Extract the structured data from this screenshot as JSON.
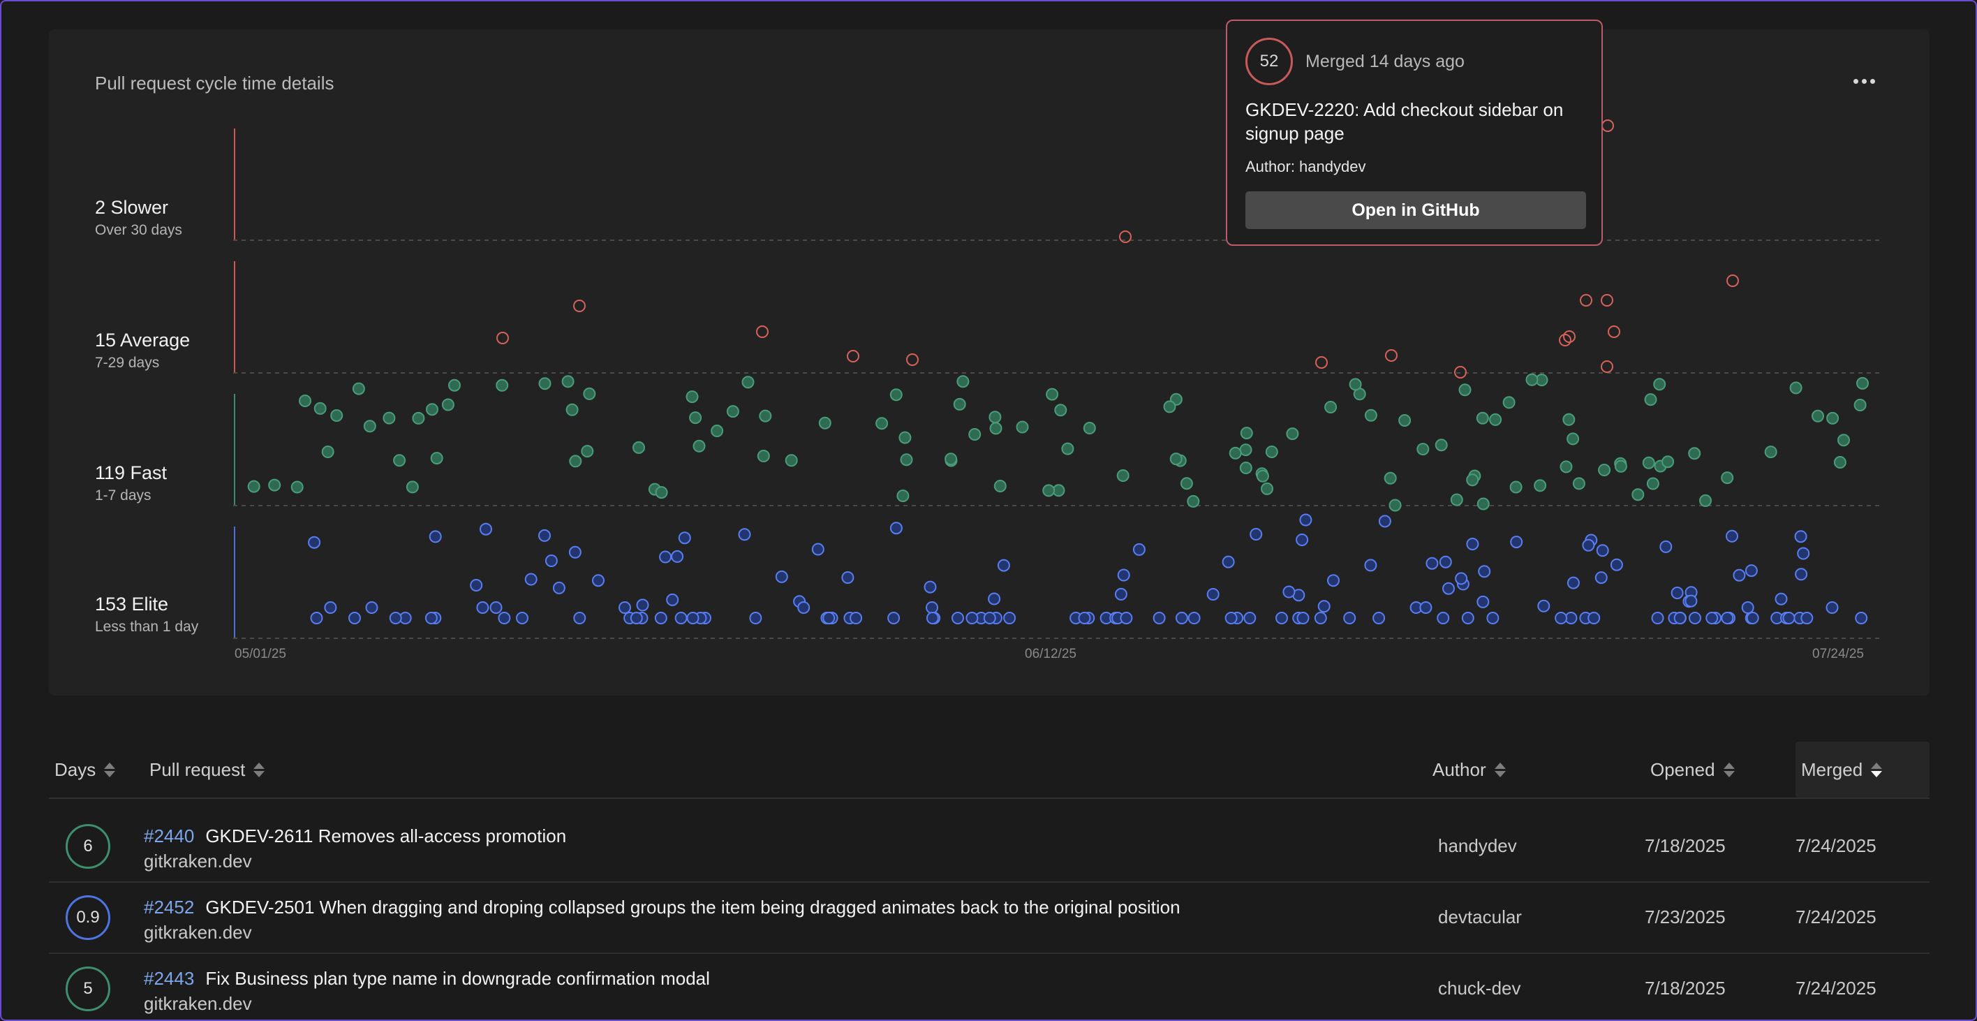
{
  "chart": {
    "title": "Pull request cycle time details",
    "x_ticks": [
      "05/01/25",
      "06/12/25",
      "07/24/25"
    ],
    "bands": [
      {
        "count_label": "2 Slower",
        "range_label": "Over 30 days"
      },
      {
        "count_label": "15 Average",
        "range_label": "7-29 days"
      },
      {
        "count_label": "119 Fast",
        "range_label": "1-7 days"
      },
      {
        "count_label": "153 Elite",
        "range_label": "Less than 1 day"
      }
    ],
    "colors": {
      "slower": "#d0574f",
      "average": "#d0574f",
      "fast": "#3f8f6f",
      "elite": "#4a6fe0"
    }
  },
  "popover": {
    "days": "52",
    "status": "Merged 14 days ago",
    "title": "GKDEV-2220: Add checkout sidebar on signup page",
    "author": "Author: handydev",
    "button_label": "Open in GitHub"
  },
  "table": {
    "columns": {
      "days": "Days",
      "pull_request": "Pull request",
      "author": "Author",
      "opened": "Opened",
      "merged": "Merged"
    },
    "active_sort": "merged",
    "rows": [
      {
        "days": "6",
        "band": "fast",
        "number": "#2440",
        "title": "GKDEV-2611 Removes all-access promotion",
        "repo": "gitkraken.dev",
        "author": "handydev",
        "opened": "7/18/2025",
        "merged": "7/24/2025"
      },
      {
        "days": "0.9",
        "band": "elite",
        "number": "#2452",
        "title": "GKDEV-2501 When dragging and droping collapsed groups the item being dragged animates back to the original position",
        "repo": "gitkraken.dev",
        "author": "devtacular",
        "opened": "7/23/2025",
        "merged": "7/24/2025"
      },
      {
        "days": "5",
        "band": "fast",
        "number": "#2443",
        "title": "Fix Business plan type name in downgrade confirmation modal",
        "repo": "gitkraken.dev",
        "author": "chuck-dev",
        "opened": "7/18/2025",
        "merged": "7/24/2025"
      }
    ]
  }
}
